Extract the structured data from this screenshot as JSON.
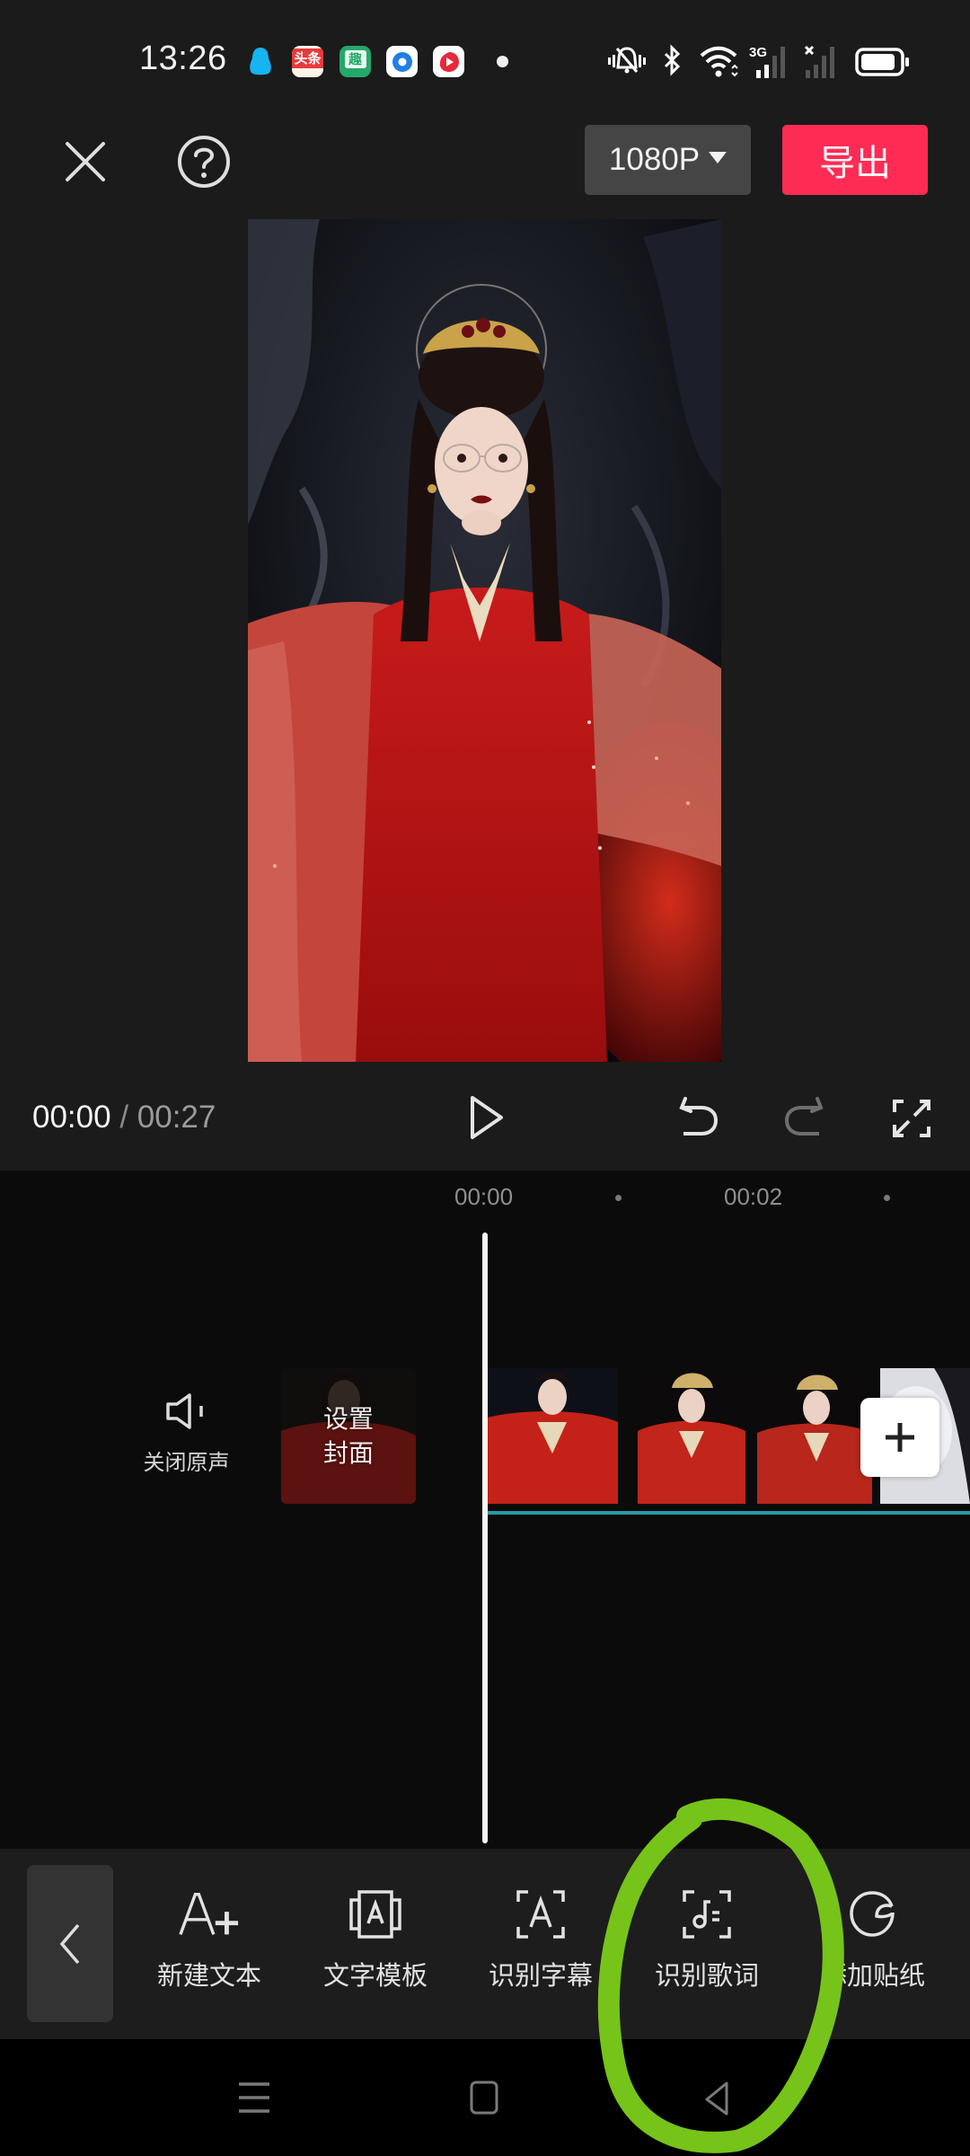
{
  "status_bar": {
    "time": "13:26",
    "notification_apps": [
      {
        "name": "qq",
        "label": ""
      },
      {
        "name": "toutiao",
        "label": "头条"
      },
      {
        "name": "qutoutiao",
        "label": "趣"
      },
      {
        "name": "browser",
        "label": ""
      },
      {
        "name": "video-app",
        "label": ""
      }
    ],
    "system_icons": [
      "mute-vibrate-icon",
      "bluetooth-icon",
      "wifi-icon",
      "signal-3g-icon",
      "signal-no-service-icon",
      "battery-icon"
    ],
    "network_type": "3G",
    "battery_level": 0.85
  },
  "top_bar": {
    "close_icon": "close-icon",
    "help_icon": "help-icon",
    "resolution": "1080P",
    "export_label": "导出",
    "export_color": "#fe2c55"
  },
  "playback": {
    "current_time": "00:00",
    "separator": " / ",
    "total_time": "00:27",
    "play_icon": "play-icon",
    "undo_icon": "undo-icon",
    "redo_icon": "redo-icon",
    "fullscreen_icon": "fullscreen-icon"
  },
  "timeline": {
    "ticks": [
      "00:00",
      "00:02"
    ],
    "mute_label": "关闭原声",
    "cover_label_line1": "设置",
    "cover_label_line2": "封面",
    "track_color": "#2a9aa6",
    "add_clip_icon": "plus-icon"
  },
  "toolbar": {
    "back_icon": "chevron-left-icon",
    "items": [
      {
        "label": "新建文本",
        "icon": "add-text-icon"
      },
      {
        "label": "文字模板",
        "icon": "text-template-icon"
      },
      {
        "label": "识别字幕",
        "icon": "recognize-subtitles-icon"
      },
      {
        "label": "识别歌词",
        "icon": "recognize-lyrics-icon"
      },
      {
        "label": "添加贴纸",
        "icon": "sticker-icon"
      }
    ]
  },
  "nav_bar": {
    "items": [
      "menu-icon",
      "home-icon",
      "back-icon"
    ]
  },
  "annotation": {
    "type": "hand-drawn-circle",
    "target": "识别歌词",
    "color": "#76c31a"
  }
}
